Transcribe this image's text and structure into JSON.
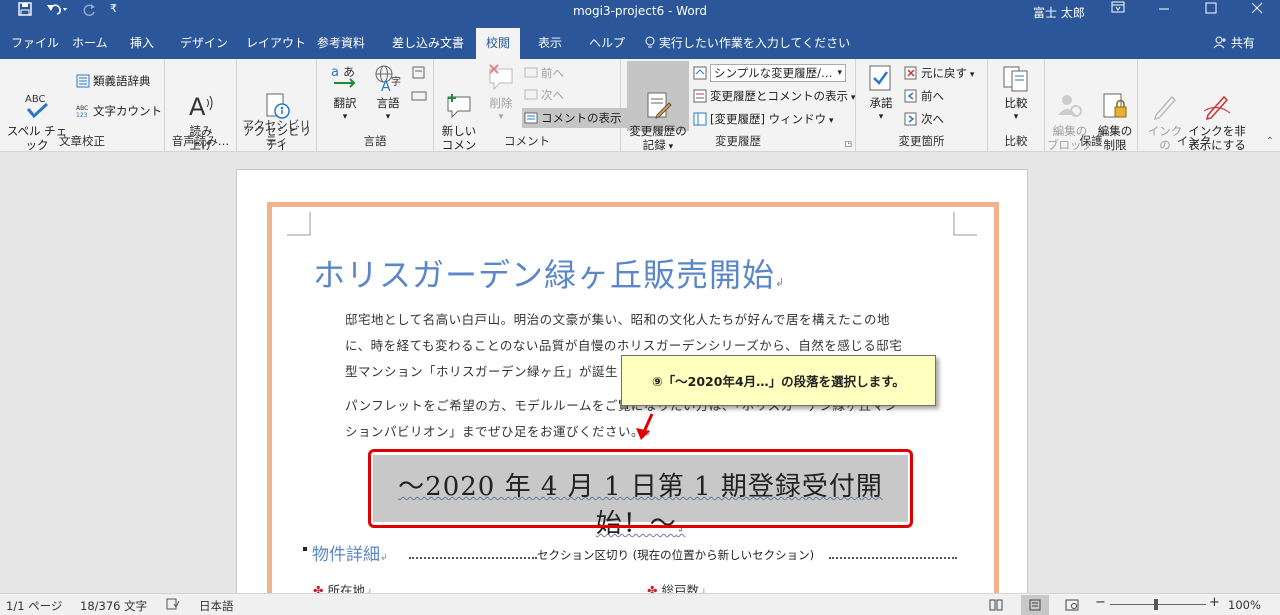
{
  "window": {
    "title": "mogi3-project6  -  Word",
    "user": "富士 太郎"
  },
  "tabs": [
    "ファイル",
    "ホーム",
    "挿入",
    "デザイン",
    "レイアウト",
    "参考資料",
    "差し込み文書",
    "校閲",
    "表示",
    "ヘルプ"
  ],
  "active_tab": "校閲",
  "tell_me": "実行したい作業を入力してください",
  "share": "共有",
  "ribbon": {
    "proofing": {
      "label": "文章校正",
      "spell_check": "スペル チェック\nと文章校正",
      "thesaurus": "類義語辞典",
      "word_count": "文字カウント"
    },
    "speech": {
      "label": "音声読み…",
      "read_aloud": "読み\n上げ"
    },
    "accessibility": {
      "label": "アクセシビリティ",
      "check": "アクセシビリティ\nチェック"
    },
    "language": {
      "label": "言語",
      "translate": "翻訳",
      "language": "言語"
    },
    "comments": {
      "label": "コメント",
      "new": "新しい\nコメント",
      "delete": "削除",
      "prev": "前へ",
      "next": "次へ",
      "show": "コメントの表示"
    },
    "tracking": {
      "label": "変更履歴",
      "track_changes": "変更履歴の\n記録",
      "markup_select": "シンプルな変更履歴/…",
      "show_markup": "変更履歴とコメントの表示",
      "pane": "[変更履歴] ウィンドウ"
    },
    "changes": {
      "label": "変更箇所",
      "accept": "承諾",
      "reject": "元に戻す",
      "prev": "前へ",
      "next": "次へ"
    },
    "compare": {
      "label": "比較",
      "compare": "比較"
    },
    "protect": {
      "label": "保護",
      "block": "編集の\nブロック",
      "restrict": "編集の\n制限"
    },
    "ink": {
      "label": "インク",
      "start": "インクの\n開始",
      "hide": "インクを非\n表示にする"
    }
  },
  "document": {
    "title": "ホリスガーデン緑ヶ丘販売開始",
    "para1_line1": "邸宅地として名高い白戸山。明治の文豪が集い、昭和の文化人たちが好んで居を構えたこの地",
    "para1_line2": "に、時を経ても変わることのない品質が自慢のホリスガーデンシリーズから、自然を感じる邸宅",
    "para1_line3": "型マンション「ホリスガーデン緑ヶ丘」が誕生",
    "para2_line1": "パンフレットをご希望の方、モデルルームをご覧になりたい方は、「ホリスガーデン緑ヶ丘マン",
    "para2_line2": "ションパビリオン」までぜひ足をお運びください。",
    "selected_para": "～2020 年 4 月 1 日第 1 期登録受付開始！～",
    "section_heading": "物件詳細",
    "section_break": "セクション区切り (現在の位置から新しいセクション)",
    "item1": "所在地",
    "item2": "総戸数"
  },
  "callout": {
    "text": "⑨「～2020年4月…」の段落を選択します。"
  },
  "status": {
    "page": "1/1 ページ",
    "words": "18/376 文字",
    "language": "日本語",
    "zoom": "100%",
    "zoom_level": 1.0
  },
  "colors": {
    "title_bar": "#2b579a",
    "heading": "#5b87c8",
    "page_border": "#f0b48c",
    "selection_outline": "#e00000",
    "callout_bg": "#ffffc0"
  }
}
